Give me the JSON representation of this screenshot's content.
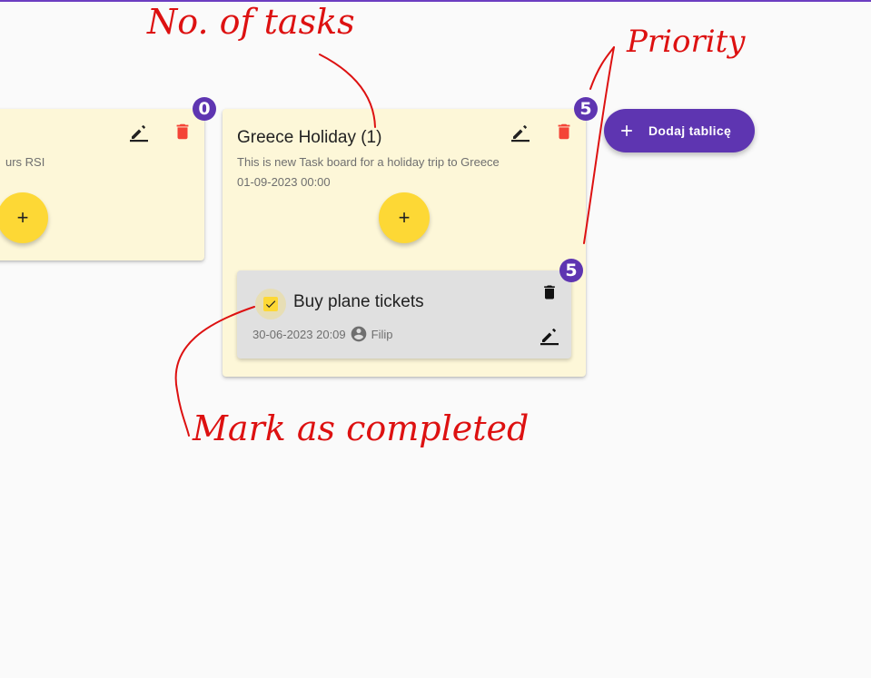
{
  "boards": [
    {
      "title": "",
      "description": "urs RSI",
      "badge": "0",
      "add_label": "+"
    },
    {
      "title": "Greece Holiday (1)",
      "description": "This is new Task board for a holiday trip to Greece",
      "date": "01-09-2023 00:00",
      "badge": "5",
      "add_label": "+",
      "tasks": [
        {
          "title": "Buy plane tickets",
          "date": "30-06-2023 20:09",
          "user": "Filip",
          "badge": "5",
          "completed": true
        }
      ]
    }
  ],
  "add_board_button": {
    "label": "Dodaj tablicę"
  },
  "annotations": {
    "tasks_count": "No. of tasks",
    "priority": "Priority",
    "mark_completed": "Mark as completed"
  },
  "colors": {
    "board_bg": "#fdf7d8",
    "accent": "#5e35b1",
    "fab": "#fdd835",
    "delete": "#f44336",
    "task_bg": "#e0e0e0",
    "annotation": "#dd1111"
  },
  "icons": [
    "edit-icon",
    "delete-icon",
    "plus-icon",
    "check-icon",
    "person-icon"
  ]
}
